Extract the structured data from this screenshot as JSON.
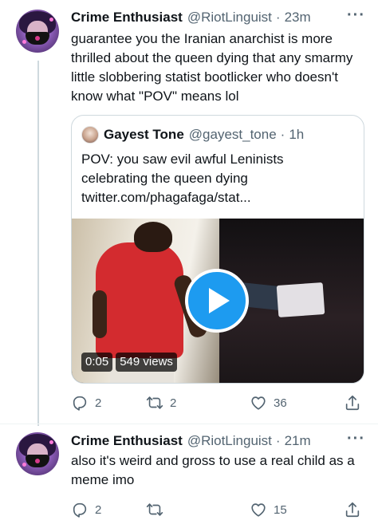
{
  "tweets": [
    {
      "name": "Crime Enthusiast",
      "handle": "@RiotLinguist",
      "separator": "·",
      "time": "23m",
      "text": "guarantee you the Iranian anarchist is more thrilled about the queen dying that any smarmy little slobbering statist bootlicker who doesn't know what \"POV\" means lol",
      "more": "···",
      "quote": {
        "name": "Gayest Tone",
        "handle": "@gayest_tone",
        "separator": "·",
        "time": "1h",
        "text": "POV: you saw evil awful Leninists celebrating the queen dying twitter.com/phagafaga/stat...",
        "video": {
          "duration": "0:05",
          "views": "549 views"
        }
      },
      "actions": {
        "replies": "2",
        "retweets": "2",
        "likes": "36"
      }
    },
    {
      "name": "Crime Enthusiast",
      "handle": "@RiotLinguist",
      "separator": "·",
      "time": "21m",
      "text": "also it's weird and gross to use a real child as a meme imo",
      "more": "···",
      "actions": {
        "replies": "2",
        "retweets": "",
        "likes": "15"
      }
    }
  ],
  "icons": {
    "reply": "reply-icon",
    "retweet": "retweet-icon",
    "like": "heart-icon",
    "share": "share-icon",
    "play": "play-icon",
    "more": "more-icon"
  },
  "colors": {
    "accent": "#1d9bf0",
    "secondary_text": "#536471",
    "primary_text": "#0f1419",
    "border": "#cfd9de"
  }
}
